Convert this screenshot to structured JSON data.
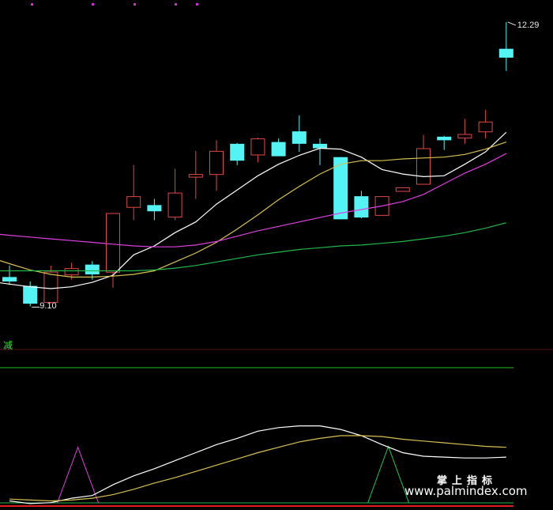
{
  "chart_data": {
    "type": "candlestick",
    "price_range": [
      8.8,
      12.45
    ],
    "high_label": "12.29",
    "low_label": "9.10",
    "candles": [
      {
        "o": 9.42,
        "h": 9.55,
        "l": 9.33,
        "c": 9.37
      },
      {
        "o": 9.32,
        "h": 9.37,
        "l": 9.09,
        "c": 9.12
      },
      {
        "o": 9.13,
        "h": 9.55,
        "l": 9.12,
        "c": 9.48
      },
      {
        "o": 9.44,
        "h": 9.58,
        "l": 9.39,
        "c": 9.52
      },
      {
        "o": 9.56,
        "h": 9.6,
        "l": 9.39,
        "c": 9.45
      },
      {
        "o": 9.47,
        "h": 10.14,
        "l": 9.3,
        "c": 10.14
      },
      {
        "o": 10.2,
        "h": 10.68,
        "l": 10.06,
        "c": 10.33
      },
      {
        "o": 10.23,
        "h": 10.3,
        "l": 10.06,
        "c": 10.16
      },
      {
        "o": 10.09,
        "h": 10.64,
        "l": 10.06,
        "c": 10.37
      },
      {
        "o": 10.54,
        "h": 10.84,
        "l": 10.3,
        "c": 10.58
      },
      {
        "o": 10.57,
        "h": 10.96,
        "l": 10.39,
        "c": 10.84
      },
      {
        "o": 10.92,
        "h": 10.93,
        "l": 10.68,
        "c": 10.73
      },
      {
        "o": 10.79,
        "h": 10.99,
        "l": 10.71,
        "c": 10.98
      },
      {
        "o": 10.94,
        "h": 10.98,
        "l": 10.82,
        "c": 10.78
      },
      {
        "o": 11.06,
        "h": 11.24,
        "l": 10.83,
        "c": 10.92
      },
      {
        "o": 10.92,
        "h": 10.98,
        "l": 10.68,
        "c": 10.87
      },
      {
        "o": 10.77,
        "h": 10.77,
        "l": 10.07,
        "c": 10.07
      },
      {
        "o": 10.33,
        "h": 10.39,
        "l": 10.08,
        "c": 10.09
      },
      {
        "o": 10.11,
        "h": 10.33,
        "l": 10.11,
        "c": 10.33
      },
      {
        "o": 10.38,
        "h": 10.43,
        "l": 10.38,
        "c": 10.43
      },
      {
        "o": 10.46,
        "h": 11.02,
        "l": 10.46,
        "c": 10.87
      },
      {
        "o": 11.0,
        "h": 11.01,
        "l": 10.85,
        "c": 10.96
      },
      {
        "o": 10.98,
        "h": 11.2,
        "l": 10.92,
        "c": 11.03
      },
      {
        "o": 11.05,
        "h": 11.3,
        "l": 10.98,
        "c": 11.17
      },
      {
        "o": 11.99,
        "h": 12.29,
        "l": 11.74,
        "c": 11.89
      }
    ],
    "ma_series": [
      {
        "color": "#ffffff",
        "values": [
          9.34,
          9.31,
          9.29,
          9.31,
          9.36,
          9.44,
          9.67,
          9.77,
          9.92,
          10.04,
          10.24,
          10.4,
          10.56,
          10.69,
          10.79,
          10.87,
          10.86,
          10.77,
          10.63,
          10.58,
          10.55,
          10.56,
          10.69,
          10.83,
          11.05
        ]
      },
      {
        "color": "#d8c050",
        "values": [
          9.57,
          9.5,
          9.45,
          9.42,
          9.42,
          9.43,
          9.45,
          9.49,
          9.59,
          9.69,
          9.81,
          9.96,
          10.12,
          10.29,
          10.44,
          10.58,
          10.69,
          10.73,
          10.73,
          10.75,
          10.76,
          10.77,
          10.8,
          10.86,
          10.94
        ]
      },
      {
        "color": "#e040e0",
        "values": [
          9.89,
          9.87,
          9.85,
          9.83,
          9.81,
          9.79,
          9.77,
          9.76,
          9.76,
          9.78,
          9.82,
          9.88,
          9.94,
          9.99,
          10.04,
          10.09,
          10.14,
          10.18,
          10.22,
          10.27,
          10.35,
          10.47,
          10.59,
          10.69,
          10.81
        ]
      },
      {
        "color": "#22b84a",
        "values": [
          9.49,
          9.49,
          9.49,
          9.49,
          9.49,
          9.49,
          9.49,
          9.5,
          9.52,
          9.55,
          9.59,
          9.63,
          9.67,
          9.7,
          9.73,
          9.75,
          9.77,
          9.78,
          9.8,
          9.82,
          9.85,
          9.88,
          9.92,
          9.97,
          10.03
        ]
      }
    ],
    "oscillator": {
      "tag": "减",
      "range": [
        0,
        100
      ],
      "fast_line": {
        "color": "#ffffff",
        "values": [
          4,
          1,
          2,
          7,
          10,
          22,
          32,
          40,
          49,
          58,
          67,
          74,
          82,
          86,
          88,
          88,
          84,
          77,
          67,
          58,
          54,
          53,
          52,
          52,
          53
        ]
      },
      "slow_line": {
        "color": "#d8c050",
        "values": [
          6,
          5,
          4,
          5,
          7,
          11,
          17,
          24,
          30,
          37,
          44,
          51,
          58,
          64,
          70,
          74,
          77,
          77,
          76,
          73,
          71,
          69,
          67,
          65,
          64
        ]
      },
      "magenta_spike": {
        "index": 3,
        "value": 64
      },
      "green_spike": {
        "index": 18,
        "value": 65
      },
      "level_line": {
        "value": 112,
        "color": "#1fc41f"
      }
    }
  },
  "watermark": {
    "line1": "掌上指标",
    "line2": "www.palmindex.com"
  }
}
